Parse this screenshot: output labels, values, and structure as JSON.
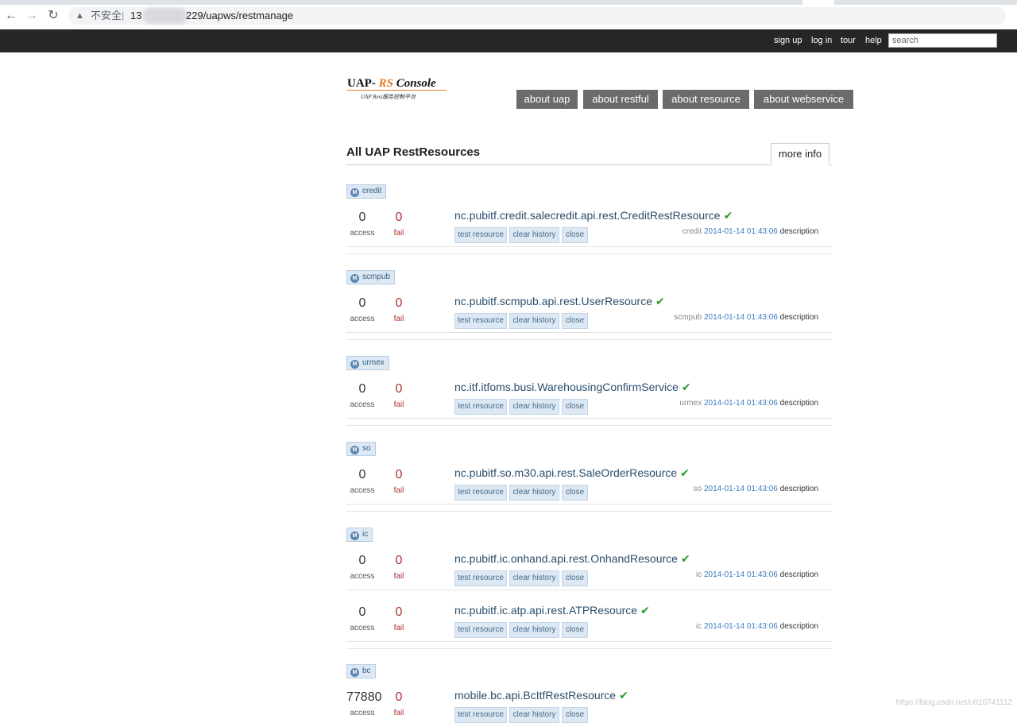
{
  "browser": {
    "insecure_label": "不安全",
    "url_separator": "|",
    "url_host": "13",
    "url_path": "229/uapws/restmanage"
  },
  "topnav": {
    "links": [
      "sign up",
      "log in",
      "tour",
      "help"
    ],
    "search_placeholder": "search"
  },
  "logo": {
    "line1_a": "UAP- ",
    "line1_b": "RS",
    "line1_c": " Console",
    "line2": "UAP Rest服务控制平台"
  },
  "tabs": [
    "about uap",
    "about restful",
    "about resource",
    "about webservice"
  ],
  "section": {
    "title": "All UAP RestResources",
    "more_info": "more info"
  },
  "labels": {
    "access": "access",
    "fail": "fail",
    "test": "test resource",
    "clear": "clear history",
    "close": "close",
    "description": "description",
    "check": "✔"
  },
  "groups": [
    {
      "tag": "credit",
      "resources": [
        {
          "access": "0",
          "fail": "0",
          "name": "nc.pubitf.credit.salecredit.api.rest.CreditRestResource",
          "module": "credit",
          "date": "2014-01-14 01:43:06"
        }
      ]
    },
    {
      "tag": "scmpub",
      "resources": [
        {
          "access": "0",
          "fail": "0",
          "name": "nc.pubitf.scmpub.api.rest.UserResource",
          "module": "scmpub",
          "date": "2014-01-14 01:43:06"
        }
      ]
    },
    {
      "tag": "urmex",
      "resources": [
        {
          "access": "0",
          "fail": "0",
          "name": "nc.itf.itfoms.busi.WarehousingConfirmService",
          "module": "urmex",
          "date": "2014-01-14 01:43:06"
        }
      ]
    },
    {
      "tag": "so",
      "resources": [
        {
          "access": "0",
          "fail": "0",
          "name": "nc.pubitf.so.m30.api.rest.SaleOrderResource",
          "module": "so",
          "date": "2014-01-14 01:43:06"
        }
      ]
    },
    {
      "tag": "ic",
      "resources": [
        {
          "access": "0",
          "fail": "0",
          "name": "nc.pubitf.ic.onhand.api.rest.OnhandResource",
          "module": "ic",
          "date": "2014-01-14 01:43:06"
        },
        {
          "access": "0",
          "fail": "0",
          "name": "nc.pubitf.ic.atp.api.rest.ATPResource",
          "module": "ic",
          "date": "2014-01-14 01:43:06"
        }
      ]
    },
    {
      "tag": "bc",
      "resources": [
        {
          "access": "77880",
          "fail": "0",
          "name": "mobile.bc.api.BcItfRestResource",
          "module": "",
          "date": ""
        }
      ]
    }
  ],
  "watermark": "https://blog.csdn.net/u010741112"
}
